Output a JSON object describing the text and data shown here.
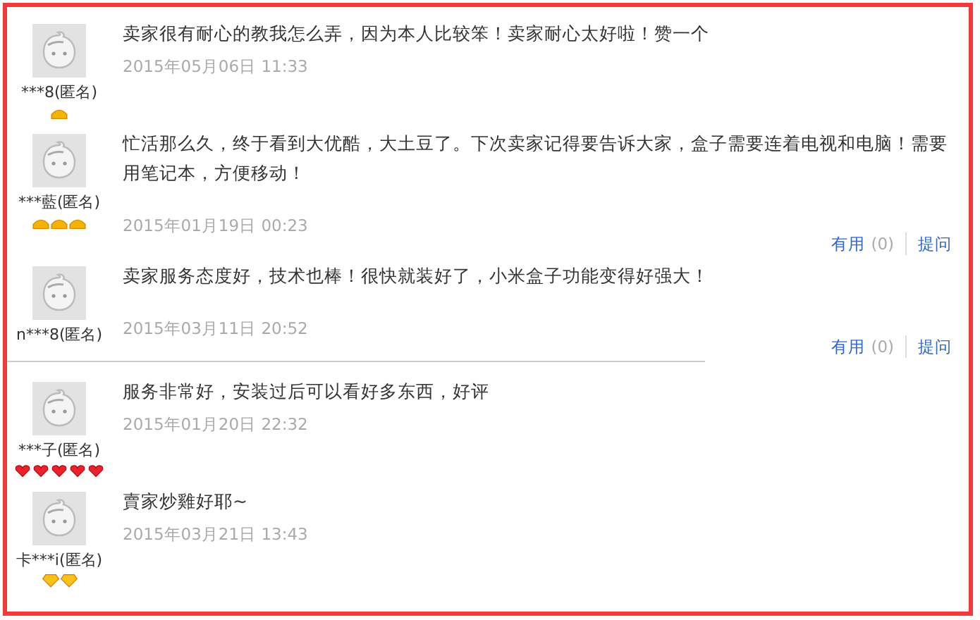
{
  "sections": [
    {
      "reviews": [
        {
          "user": "***8(匿名)",
          "badges": [
            {
              "kind": "crown"
            }
          ],
          "text": "卖家很有耐心的教我怎么弄，因为本人比较笨！卖家耐心太好啦！赞一个",
          "date": "2015年05月06日 11:33"
        },
        {
          "user": "***藍(匿名)",
          "badges": [
            {
              "kind": "crown"
            },
            {
              "kind": "crown"
            },
            {
              "kind": "crown"
            }
          ],
          "text": "忙活那么久，终于看到大优酷，大土豆了。下次卖家记得要告诉大家，盒子需要连着电视和电脑！需要用笔记本，方便移动！",
          "date": "2015年01月19日 00:23",
          "actions": {
            "useful": "有用",
            "count": "(0)",
            "ask": "提问"
          }
        },
        {
          "user": "n***8(匿名)",
          "text": "卖家服务态度好，技术也棒！很快就装好了，小米盒子功能变得好强大！",
          "date": "2015年03月11日 20:52",
          "actions": {
            "useful": "有用",
            "count": "(0)",
            "ask": "提问"
          }
        }
      ]
    },
    {
      "reviews": [
        {
          "user": "***子(匿名)",
          "badges": [
            {
              "kind": "heart"
            },
            {
              "kind": "heart"
            },
            {
              "kind": "heart"
            },
            {
              "kind": "heart"
            },
            {
              "kind": "heart"
            }
          ],
          "text": "服务非常好，安装过后可以看好多东西，好评",
          "date": "2015年01月20日 22:32"
        },
        {
          "user": "卡***i(匿名)",
          "badges": [
            {
              "kind": "diamond"
            },
            {
              "kind": "diamond"
            }
          ],
          "text": "賣家炒雞好耶~",
          "date": "2015年03月21日 13:43"
        }
      ]
    }
  ]
}
